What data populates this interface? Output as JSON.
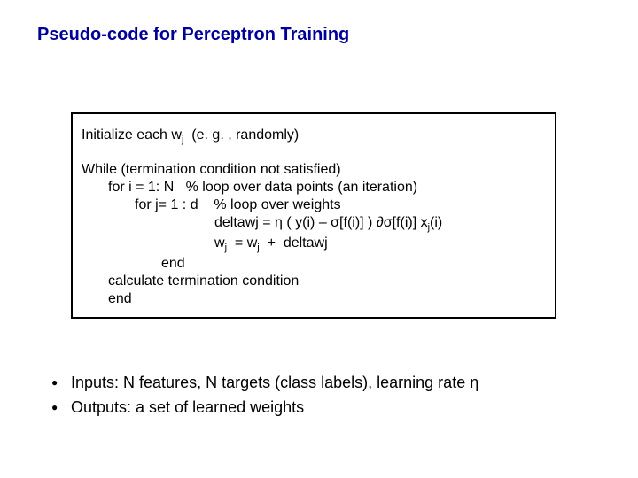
{
  "title": "Pseudo-code for Perceptron Training",
  "code": {
    "init_a": "Initialize each w",
    "init_sub": "j",
    "init_b": "  (e. g. , randomly)",
    "while_line": "While (termination condition not satisfied)",
    "for_i": "for i = 1: N   % loop over data points (an iteration)",
    "for_j": "for j= 1 : d    % loop over weights",
    "delta_a": "deltawj = ",
    "eta": "η",
    "delta_b": " ( y(i) – ",
    "sigma1": "σ",
    "delta_c": "[f(i)] ) ",
    "partial": "∂",
    "sigma2": "σ",
    "delta_d": "[f(i)] x",
    "delta_sub": "j",
    "delta_e": "(i)",
    "update_a": "w",
    "update_sub1": "j",
    "update_b": "  = w",
    "update_sub2": "j",
    "update_c": "  +  deltawj",
    "end1": "end",
    "calc": "calculate termination condition",
    "end2": "end"
  },
  "bullets": {
    "b1a": "Inputs:  N features, N targets (class labels), learning rate ",
    "b1_eta": "η",
    "b2": "Outputs: a set of learned weights"
  }
}
